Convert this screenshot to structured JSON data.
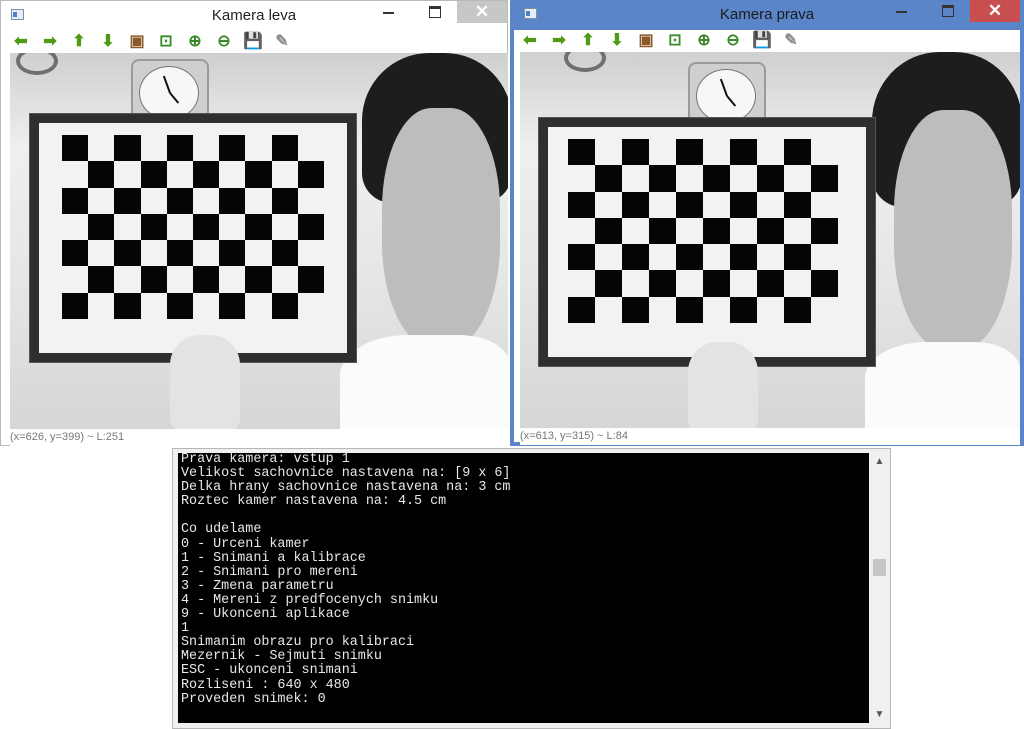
{
  "left_window": {
    "title": "Kamera leva",
    "status": "(x=626, y=399) ~ L:251",
    "toolbar": [
      {
        "icon": "arrow-left-icon",
        "glyph": "⬅"
      },
      {
        "icon": "arrow-right-icon",
        "glyph": "➡"
      },
      {
        "icon": "arrow-up-icon",
        "glyph": "⬆"
      },
      {
        "icon": "arrow-down-icon",
        "glyph": "⬇"
      },
      {
        "icon": "image-icon",
        "glyph": "▣"
      },
      {
        "icon": "zoom-fit-icon",
        "glyph": "⊡"
      },
      {
        "icon": "zoom-in-icon",
        "glyph": "⊕"
      },
      {
        "icon": "zoom-out-icon",
        "glyph": "⊖"
      },
      {
        "icon": "save-icon",
        "glyph": "💾"
      },
      {
        "icon": "brush-icon",
        "glyph": "✎"
      }
    ],
    "close_glyph": "✕"
  },
  "right_window": {
    "title": "Kamera prava",
    "status": "(x=613, y=315) ~ L:84",
    "toolbar": [
      {
        "icon": "arrow-left-icon",
        "glyph": "⬅"
      },
      {
        "icon": "arrow-right-icon",
        "glyph": "➡"
      },
      {
        "icon": "arrow-up-icon",
        "glyph": "⬆"
      },
      {
        "icon": "arrow-down-icon",
        "glyph": "⬇"
      },
      {
        "icon": "image-icon",
        "glyph": "▣"
      },
      {
        "icon": "zoom-fit-icon",
        "glyph": "⊡"
      },
      {
        "icon": "zoom-in-icon",
        "glyph": "⊕"
      },
      {
        "icon": "zoom-out-icon",
        "glyph": "⊖"
      },
      {
        "icon": "save-icon",
        "glyph": "💾"
      },
      {
        "icon": "brush-icon",
        "glyph": "✎"
      }
    ],
    "close_glyph": "✕"
  },
  "console": {
    "lines": [
      "Prava kamera: vstup 1",
      "Velikost sachovnice nastavena na: [9 x 6]",
      "Delka hrany sachovnice nastavena na: 3 cm",
      "Roztec kamer nastavena na: 4.5 cm",
      "",
      "Co udelame",
      "0 - Urceni kamer",
      "1 - Snimani a kalibrace",
      "2 - Snimani pro mereni",
      "3 - Zmena parametru",
      "4 - Mereni z predfocenych snimku",
      "9 - Ukonceni aplikace",
      "1",
      "Snimanim obrazu pro kalibraci",
      "Mezernik - Sejmuti snimku",
      "ESC - ukonceni snimani",
      "Rozliseni : 640 x 480",
      "Proveden snimek: 0"
    ],
    "scroll_up": "▲",
    "scroll_down": "▼"
  },
  "colors": {
    "active_border": "#5a86c9",
    "close_active": "#c94f4f",
    "console_bg": "#000000",
    "console_text": "#e8e8e8"
  }
}
